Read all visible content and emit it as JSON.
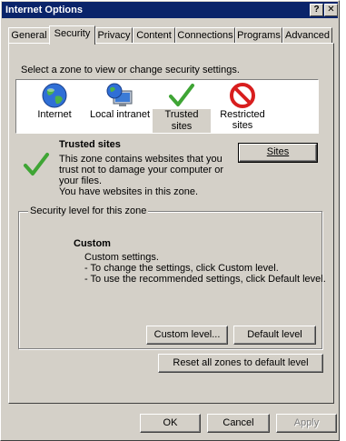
{
  "window": {
    "title": "Internet Options",
    "help_glyph": "?",
    "close_glyph": "✕"
  },
  "tabs": [
    {
      "label": "General"
    },
    {
      "label": "Security"
    },
    {
      "label": "Privacy"
    },
    {
      "label": "Content"
    },
    {
      "label": "Connections"
    },
    {
      "label": "Programs"
    },
    {
      "label": "Advanced"
    }
  ],
  "active_tab": "Security",
  "security": {
    "zone_prompt": "Select a zone to view or change security settings.",
    "zones": [
      {
        "label": "Internet",
        "icon": "globe-icon"
      },
      {
        "label": "Local intranet",
        "icon": "monitor-globe-icon"
      },
      {
        "label": "Trusted sites",
        "icon": "checkmark-icon",
        "selected": true
      },
      {
        "label": "Restricted sites",
        "icon": "prohibited-icon"
      }
    ],
    "zone_info": {
      "title": "Trusted sites",
      "desc_line1": "This zone contains websites that you",
      "desc_line2": "trust not to damage your computer or",
      "desc_line3": "your files.",
      "desc_line4": "You have websites in this zone."
    },
    "sites_button": "Sites",
    "level_group_title": "Security level for this zone",
    "level": {
      "name": "Custom",
      "line1": "Custom settings.",
      "line2": "- To change the settings, click Custom level.",
      "line3": "- To use the recommended settings, click Default level."
    },
    "custom_level_button": "Custom level...",
    "default_level_button": "Default level",
    "reset_button": "Reset all zones to default level"
  },
  "footer": {
    "ok": "OK",
    "cancel": "Cancel",
    "apply": "Apply"
  },
  "colors": {
    "titlebar": "#0a246a",
    "dialog": "#d4d0c8",
    "check_green": "#3fa535",
    "prohibited_red": "#d81e1e"
  }
}
